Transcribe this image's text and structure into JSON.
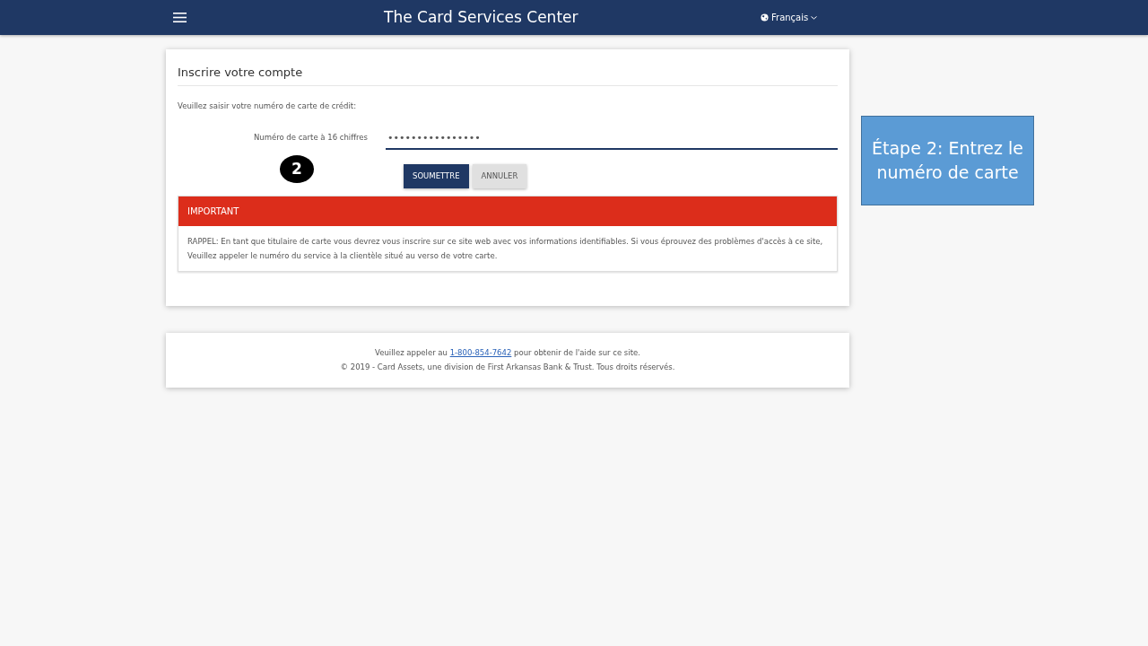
{
  "navbar": {
    "title": "The Card Services Center",
    "language": "Français"
  },
  "card": {
    "title": "Inscrire votre compte",
    "instruction": "Veuillez saisir votre numéro de carte de crédit:",
    "field": {
      "label": "Numéro de carte à 16 chiffres",
      "value": "••••••••••••••••"
    },
    "buttons": [
      {
        "label": "SOUMETTRE",
        "kind": "primary"
      },
      {
        "label": "ANNULER",
        "kind": "secondary"
      }
    ],
    "alert": {
      "title": "IMPORTANT",
      "text": "RAPPEL: En tant que titulaire de carte vous devrez vous inscrire sur ce site web avec vos informations identifiables. Si vous éprouvez des problèmes d'accès à ce site, Veuillez appeler le numéro du service à la clientèle situé au verso de votre carte."
    }
  },
  "footer": {
    "text_before": "Veuillez appeler au",
    "phone": "1-800-854-7642",
    "text_after": "pour obtenir de l'aide sur ce site.",
    "copyright": "© 2019 - Card Assets, une division de First Arkansas Bank & Trust. Tous droits réservés."
  },
  "annotation": {
    "step_marker": "2",
    "callout": "Étape 2: Entrez le numéro de carte"
  }
}
